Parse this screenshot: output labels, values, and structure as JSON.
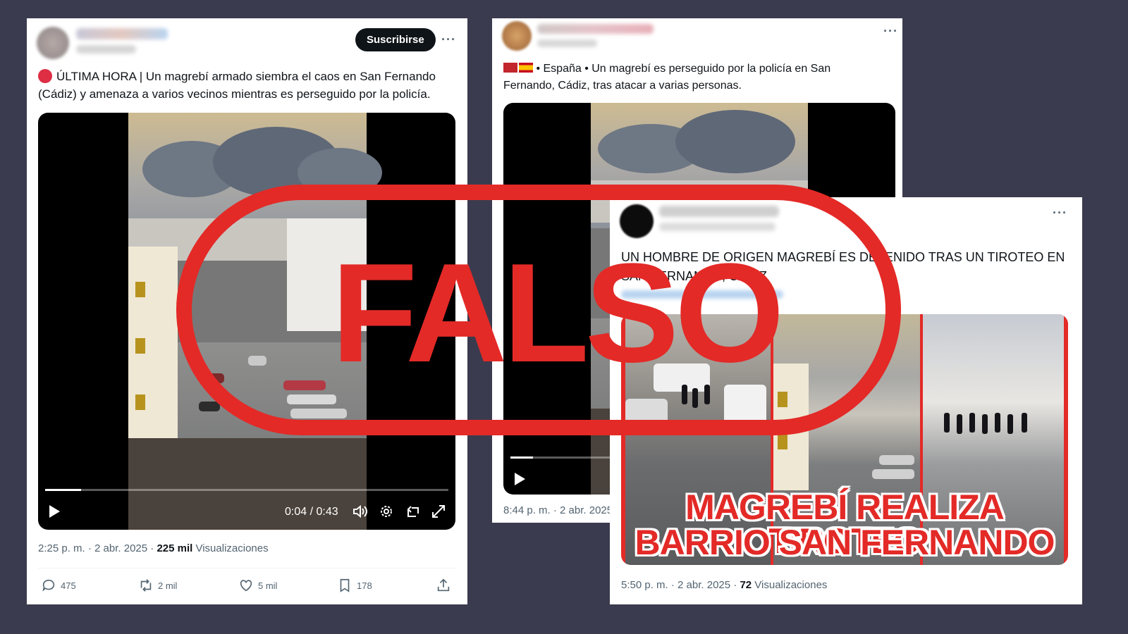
{
  "stamp": {
    "label": "FALSO",
    "color": "#e32a27"
  },
  "posts": [
    {
      "subscribe_label": "Suscribirse",
      "more_label": "···",
      "text": "ÚLTIMA HORA | Un magrebí armado siembra el caos en San Fernando (Cádiz) y amenaza a varios vecinos mientras es perseguido por la policía.",
      "video_time": "0:04 / 0:43",
      "progress_fraction": 0.09,
      "timestamp": "2:25 p. m. · 2 abr. 2025 · ",
      "views_count": "225 mil",
      "views_label": " Visualizaciones",
      "actions": {
        "replies": "475",
        "reposts": "2 mil",
        "likes": "5 mil",
        "bookmarks": "178"
      }
    },
    {
      "more_label": "···",
      "text": " • España • Un magrebí es perseguido por la policía en San Fernando, Cádiz, tras atacar a varias personas.",
      "timestamp": "8:44 p. m. · 2 abr. 2025",
      "flags": [
        "morocco-flag-icon",
        "spain-flag-icon"
      ]
    },
    {
      "more_label": "···",
      "text": "UN HOMBRE DE ORIGEN MAGREBÍ ES DETENIDO TRAS UN TIROTEO EN SAN FERNANDO, CÁDIZ",
      "banner_line1": "MAGREBÍ REALIZA TIROTEO",
      "banner_line2": "BARRIO SAN FERNANDO",
      "timestamp": "5:50 p. m. · 2 abr. 2025 · ",
      "views_count": "72",
      "views_label": " Visualizaciones"
    }
  ]
}
